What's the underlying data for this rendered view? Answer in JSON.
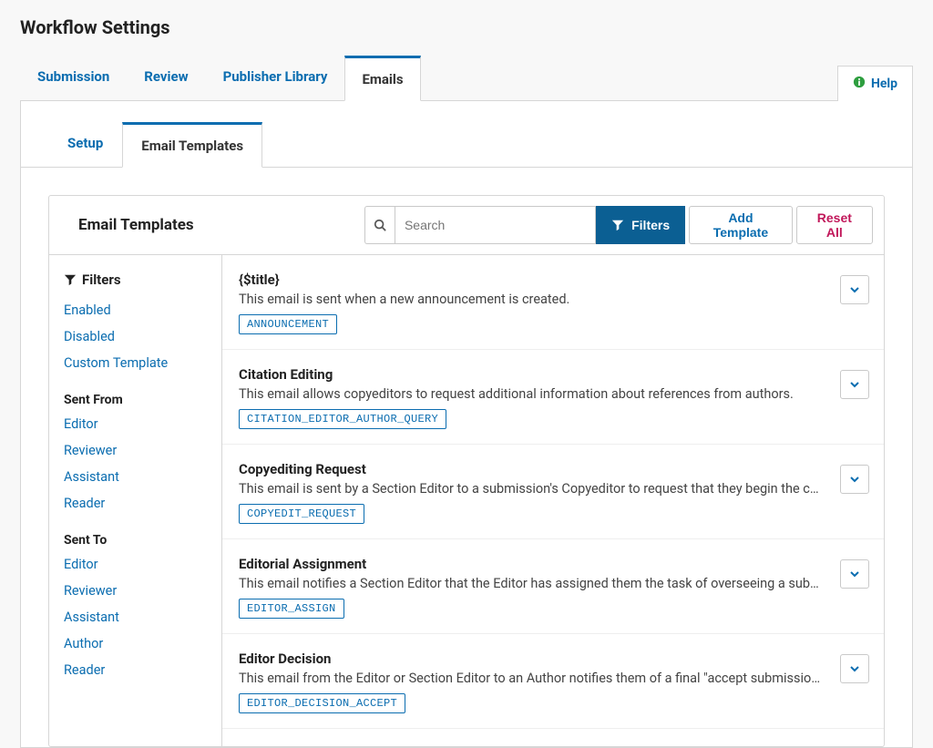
{
  "page_title": "Workflow Settings",
  "primary_tabs": [
    {
      "label": "Submission",
      "active": false
    },
    {
      "label": "Review",
      "active": false
    },
    {
      "label": "Publisher Library",
      "active": false
    },
    {
      "label": "Emails",
      "active": true
    }
  ],
  "help_label": "Help",
  "sub_tabs": [
    {
      "label": "Setup",
      "active": false
    },
    {
      "label": "Email Templates",
      "active": true
    }
  ],
  "toolbar": {
    "heading": "Email Templates",
    "search_placeholder": "Search",
    "filters_label": "Filters",
    "add_label": "Add Template",
    "reset_label": "Reset All"
  },
  "sidebar": {
    "filters_heading": "Filters",
    "status_links": [
      "Enabled",
      "Disabled",
      "Custom Template"
    ],
    "sent_from_heading": "Sent From",
    "sent_from_links": [
      "Editor",
      "Reviewer",
      "Assistant",
      "Reader"
    ],
    "sent_to_heading": "Sent To",
    "sent_to_links": [
      "Editor",
      "Reviewer",
      "Assistant",
      "Author",
      "Reader"
    ]
  },
  "templates": [
    {
      "title": "{$title}",
      "desc": "This email is sent when a new announcement is created.",
      "code": "ANNOUNCEMENT"
    },
    {
      "title": "Citation Editing",
      "desc": "This email allows copyeditors to request additional information about references from authors.",
      "code": "CITATION_EDITOR_AUTHOR_QUERY"
    },
    {
      "title": "Copyediting Request",
      "desc": "This email is sent by a Section Editor to a submission's Copyeditor to request that they begin the copyediting process.",
      "code": "COPYEDIT_REQUEST"
    },
    {
      "title": "Editorial Assignment",
      "desc": "This email notifies a Section Editor that the Editor has assigned them the task of overseeing a submission.",
      "code": "EDITOR_ASSIGN"
    },
    {
      "title": "Editor Decision",
      "desc": "This email from the Editor or Section Editor to an Author notifies them of a final \"accept submission\" decision.",
      "code": "EDITOR_DECISION_ACCEPT"
    }
  ]
}
